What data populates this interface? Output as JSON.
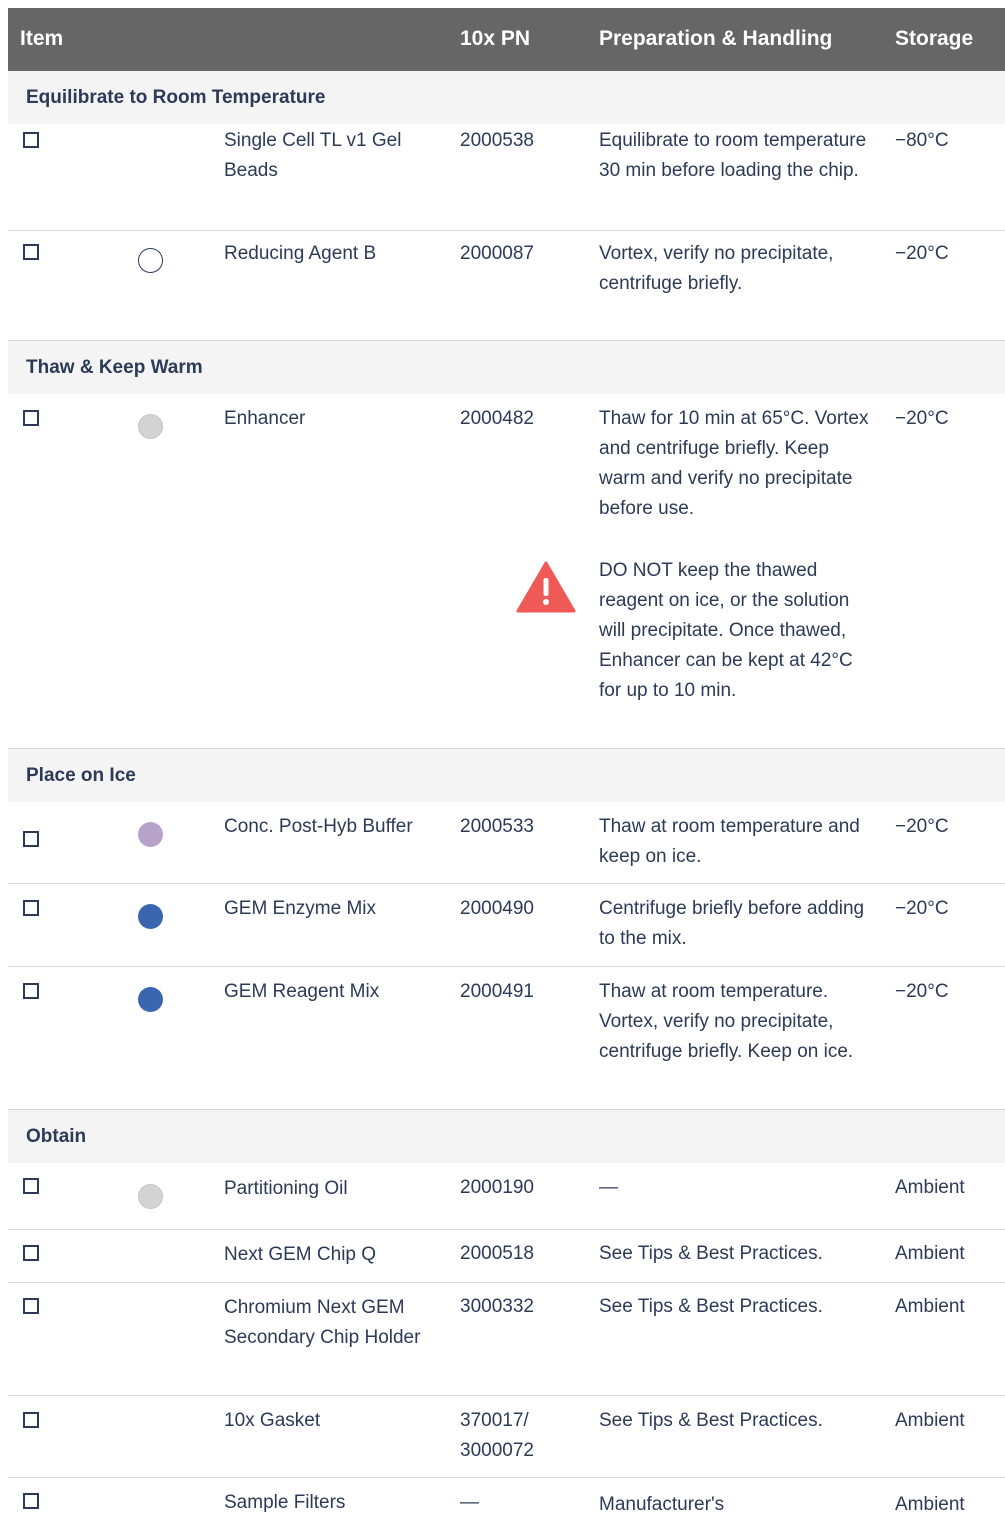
{
  "header": {
    "item": "Item",
    "pn": "10x PN",
    "prep": "Preparation & Handling",
    "storage": "Storage"
  },
  "sections": [
    {
      "title": "Equilibrate to Room Temperature"
    },
    {
      "title": "Thaw & Keep Warm"
    },
    {
      "title": "Place on Ice"
    },
    {
      "title": "Obtain"
    }
  ],
  "rows": [
    {
      "name": "Single Cell TL v1 Gel Beads",
      "pn": "2000538",
      "prep": "Equilibrate to room temperature 30 min before loading the chip.",
      "storage": "−80°C",
      "dot": "none"
    },
    {
      "name": "Reducing Agent B",
      "pn": "2000087",
      "prep": "Vortex, verify no precipitate, centrifuge briefly.",
      "storage": "−20°C",
      "dot": "white"
    },
    {
      "name": "Enhancer",
      "pn": "2000482",
      "prep": "Thaw for 10 min at 65°C. Vortex and centrifuge briefly. Keep warm and verify no precipitate before use.",
      "prep_warning": "DO NOT keep the thawed reagent on ice, or the solution will precipitate. Once thawed, Enhancer can be kept at 42°C for up to 10 min.",
      "storage": "−20°C",
      "dot": "gray"
    },
    {
      "name": "Conc. Post-Hyb Buffer",
      "pn": "2000533",
      "prep": "Thaw at room temperature and keep on ice.",
      "storage": "−20°C",
      "dot": "lavender"
    },
    {
      "name": "GEM Enzyme Mix",
      "pn": "2000490",
      "prep": "Centrifuge briefly before adding to the mix.",
      "storage": "−20°C",
      "dot": "blue"
    },
    {
      "name": "GEM Reagent Mix",
      "pn": "2000491",
      "prep": "Thaw at room temperature. Vortex, verify no precipitate, centrifuge briefly. Keep on ice.",
      "storage": "−20°C",
      "dot": "blue"
    },
    {
      "name": "Partitioning Oil",
      "pn": "2000190",
      "prep": "—",
      "storage": "Ambient",
      "dot": "gray"
    },
    {
      "name": "Next GEM Chip Q",
      "pn": "2000518",
      "prep": "See Tips & Best Practices.",
      "storage": "Ambient",
      "dot": "none"
    },
    {
      "name": "Chromium Next GEM Secondary Chip Holder",
      "pn": "3000332",
      "prep": "See Tips & Best Practices.",
      "storage": "Ambient",
      "dot": "none"
    },
    {
      "name": "10x Gasket",
      "pn": "370017/ 3000072",
      "prep": "See Tips & Best Practices.",
      "storage": "Ambient",
      "dot": "none"
    },
    {
      "name": "Sample Filters",
      "pn": "—",
      "prep": "Manufacturer's",
      "storage": "Ambient",
      "dot": "none"
    }
  ],
  "colors": {
    "header_bg": "#666666",
    "section_bg": "#f4f4f4",
    "text": "#2d3a57",
    "gray_dot": "#d3d3d3",
    "lavender_dot": "#b7a3c9",
    "blue_dot": "#3a66b0",
    "warning": "#ef5a57"
  },
  "icons": {
    "warning": "warning-triangle-icon",
    "checkbox": "checkbox-icon"
  }
}
